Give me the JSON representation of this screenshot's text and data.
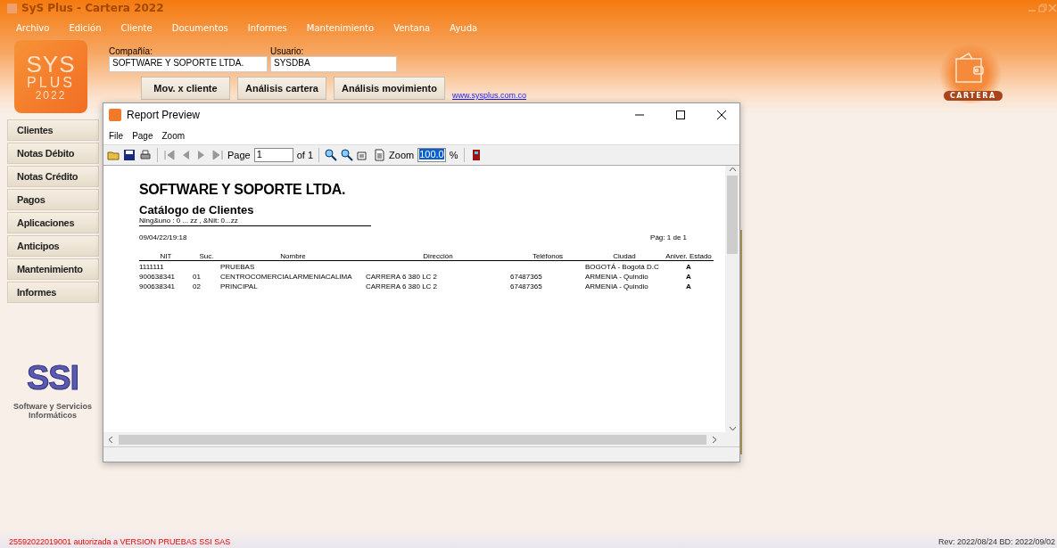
{
  "window": {
    "title": "SyS Plus - Cartera 2022"
  },
  "menu": [
    "Archivo",
    "Edición",
    "Cliente",
    "Documentos",
    "Informes",
    "Mantenimiento",
    "Ventana",
    "Ayuda"
  ],
  "logo": {
    "line1": "SYS",
    "line2": "PLUS",
    "year": "2022"
  },
  "fields": [
    {
      "label": "Compañía:",
      "value": "SOFTWARE Y SOPORTE LTDA."
    },
    {
      "label": "Usuario:",
      "value": "SYSDBA"
    }
  ],
  "actions": [
    "Mov. x cliente",
    "Análisis cartera",
    "Análisis movimiento"
  ],
  "link": "www.sysplus.com.co",
  "module_badge": "CARTERA",
  "sidebar": [
    "Clientes",
    "Notas Débito",
    "Notas Crédito",
    "Pagos",
    "Aplicaciones",
    "Anticipos",
    "Mantenimiento",
    "Informes"
  ],
  "company_logo": {
    "mark": "SSI",
    "caption": "Software y Servicios Informáticos"
  },
  "report_window": {
    "title": "Report Preview",
    "menu": [
      "File",
      "Page",
      "Zoom"
    ],
    "toolbar": {
      "page_label": "Page",
      "page": "1",
      "of": "of 1",
      "zoom_label": "Zoom",
      "zoom": "100.0",
      "percent": "%"
    },
    "report": {
      "company": "SOFTWARE Y SOPORTE LTDA.",
      "title": "Catálogo de Clientes",
      "filter": "Ning&uno : 0 ... zz , &Nit: 0...zz",
      "date": "09/04/22/19:18",
      "page": "Pág: 1 de 1",
      "columns": [
        "NIT",
        "Suc.",
        "Nombre",
        "Dirección",
        "Teléfonos",
        "Ciudad",
        "Aniver. Estado"
      ],
      "rows": [
        [
          "1111111",
          "",
          "PRUEBAS",
          "",
          "",
          "BOGOTÁ - Bogotá D.C",
          "A"
        ],
        [
          "900638341",
          "01",
          "CENTROCOMERCIALARMENIACALIMA",
          "CARRERA 6 380 LC 2",
          "67487365",
          "ARMENIA - Quindio",
          "A"
        ],
        [
          "900638341",
          "02",
          "PRINCIPAL",
          "CARRERA 6 380 LC 2",
          "67487365",
          "ARMENIA - Quindio",
          "A"
        ]
      ]
    }
  },
  "status_bar": {
    "left": "25592022019001 autorizada a VERSION PRUEBAS SSI SAS",
    "right": "Rev: 2022/08/24 BD: 2022/09/02"
  }
}
